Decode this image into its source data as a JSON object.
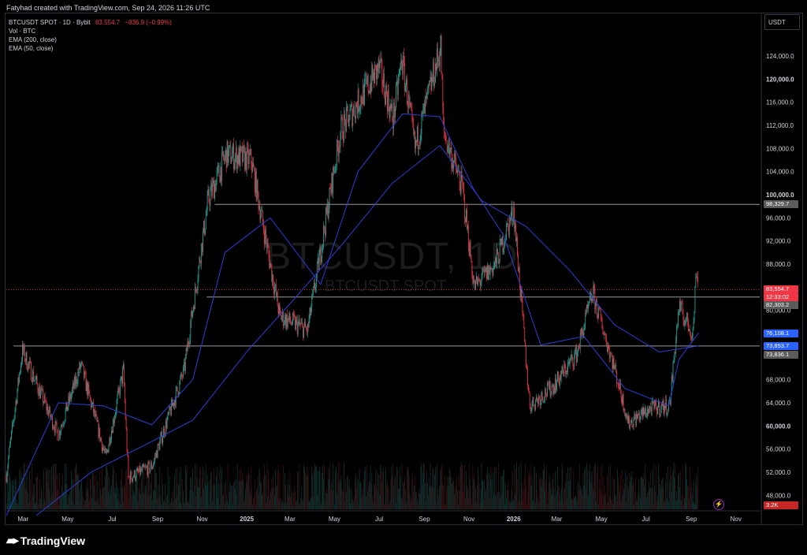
{
  "header": {
    "caption": "Fatyhad created with TradingView.com, Sep 24, 2026 11:26 UTC"
  },
  "legend": {
    "symbol": "BTCUSDT SPOT · 1D · Bybit",
    "price": "83,554.7",
    "change": "−836.9 (−0.99%)",
    "indicators": [
      "Vol · BTC",
      "EMA (200, close)",
      "EMA (50, close)"
    ]
  },
  "currency": "USDT",
  "watermark": {
    "main": "BTCUSDT, 1D",
    "sub": "BTCUSDT SPOT"
  },
  "footer": {
    "brand": "TradingView"
  },
  "colors": {
    "background": "#000000",
    "up": "#26a69a",
    "down": "#f23645",
    "ema": "#2a3fd1",
    "hline": "#9a9a9a",
    "current": "#f23645"
  },
  "chart_data": {
    "type": "candlestick",
    "title": "BTCUSDT, 1D",
    "x_axis_labels": [
      "Mar",
      "May",
      "Jul",
      "Sep",
      "Nov",
      "2025",
      "Mar",
      "May",
      "Jul",
      "Sep",
      "Nov",
      "2026",
      "Mar",
      "May",
      "Jul",
      "Sep",
      "Nov"
    ],
    "y_axis_labels": [
      "124,000.0",
      "120,000.0",
      "116,000.0",
      "112,000.0",
      "108,000.0",
      "104,000.0",
      "100,000.0",
      "96,000.0",
      "92,000.0",
      "88,000.0",
      "80,000.0",
      "68,000.0",
      "64,000.0",
      "60,000.0",
      "56,000.0",
      "52,000.0",
      "48,000.0"
    ],
    "ylim": [
      44500,
      124000
    ],
    "close_series": [
      {
        "date": "2024-02-20",
        "close": 51500
      },
      {
        "date": "2024-03-13",
        "close": 73000
      },
      {
        "date": "2024-05-01",
        "close": 58500
      },
      {
        "date": "2024-06-01",
        "close": 70500
      },
      {
        "date": "2024-07-05",
        "close": 54500
      },
      {
        "date": "2024-07-29",
        "close": 69500
      },
      {
        "date": "2024-08-05",
        "close": 51000
      },
      {
        "date": "2024-09-06",
        "close": 53000
      },
      {
        "date": "2024-10-20",
        "close": 69500
      },
      {
        "date": "2024-11-22",
        "close": 99000
      },
      {
        "date": "2024-12-17",
        "close": 107000
      },
      {
        "date": "2025-01-20",
        "close": 106000
      },
      {
        "date": "2025-02-28",
        "close": 79000
      },
      {
        "date": "2025-04-07",
        "close": 76500
      },
      {
        "date": "2025-05-22",
        "close": 111000
      },
      {
        "date": "2025-07-14",
        "close": 122000
      },
      {
        "date": "2025-08-02",
        "close": 113000
      },
      {
        "date": "2025-08-14",
        "close": 123500
      },
      {
        "date": "2025-09-01",
        "close": 108000
      },
      {
        "date": "2025-10-06",
        "close": 125500
      },
      {
        "date": "2025-10-10",
        "close": 111000
      },
      {
        "date": "2025-11-05",
        "close": 101000
      },
      {
        "date": "2025-11-21",
        "close": 84000
      },
      {
        "date": "2025-12-20",
        "close": 88000
      },
      {
        "date": "2026-01-14",
        "close": 97500
      },
      {
        "date": "2026-02-05",
        "close": 63500
      },
      {
        "date": "2026-03-10",
        "close": 67000
      },
      {
        "date": "2026-04-10",
        "close": 72500
      },
      {
        "date": "2026-05-02",
        "close": 83000
      },
      {
        "date": "2026-06-01",
        "close": 70000
      },
      {
        "date": "2026-06-20",
        "close": 60500
      },
      {
        "date": "2026-07-20",
        "close": 63000
      },
      {
        "date": "2026-08-15",
        "close": 63500
      },
      {
        "date": "2026-08-28",
        "close": 80500
      },
      {
        "date": "2026-09-16",
        "close": 76000
      },
      {
        "date": "2026-09-21",
        "close": 87500
      },
      {
        "date": "2026-09-24",
        "close": 83554.7
      }
    ],
    "ema50": [
      {
        "date": "2024-02-20",
        "value": 44500
      },
      {
        "date": "2024-05-01",
        "value": 64000
      },
      {
        "date": "2024-07-01",
        "value": 63500
      },
      {
        "date": "2024-09-06",
        "value": 60200
      },
      {
        "date": "2024-11-01",
        "value": 68000
      },
      {
        "date": "2024-12-15",
        "value": 90000
      },
      {
        "date": "2025-02-15",
        "value": 96000
      },
      {
        "date": "2025-04-25",
        "value": 84500
      },
      {
        "date": "2025-06-15",
        "value": 104000
      },
      {
        "date": "2025-08-15",
        "value": 114000
      },
      {
        "date": "2025-10-05",
        "value": 113500
      },
      {
        "date": "2025-11-20",
        "value": 101000
      },
      {
        "date": "2025-12-31",
        "value": 93000
      },
      {
        "date": "2026-02-20",
        "value": 74000
      },
      {
        "date": "2026-04-20",
        "value": 75500
      },
      {
        "date": "2026-06-15",
        "value": 66500
      },
      {
        "date": "2026-08-14",
        "value": 63500
      },
      {
        "date": "2026-08-28",
        "value": 71500
      },
      {
        "date": "2026-09-24",
        "value": 76108.1
      }
    ],
    "ema200": [
      {
        "date": "2024-04-01",
        "value": 44500
      },
      {
        "date": "2024-06-15",
        "value": 52000
      },
      {
        "date": "2024-09-01",
        "value": 57000
      },
      {
        "date": "2024-11-01",
        "value": 61000
      },
      {
        "date": "2025-01-15",
        "value": 73000
      },
      {
        "date": "2025-03-20",
        "value": 82000
      },
      {
        "date": "2025-05-25",
        "value": 91500
      },
      {
        "date": "2025-08-01",
        "value": 102000
      },
      {
        "date": "2025-10-05",
        "value": 108500
      },
      {
        "date": "2025-12-01",
        "value": 99000
      },
      {
        "date": "2026-01-31",
        "value": 94500
      },
      {
        "date": "2026-03-31",
        "value": 87000
      },
      {
        "date": "2026-06-01",
        "value": 77500
      },
      {
        "date": "2026-08-01",
        "value": 72800
      },
      {
        "date": "2026-09-24",
        "value": 73853.7
      }
    ],
    "horizontal_levels": [
      {
        "label": "98,329.7",
        "value": 98329.7,
        "from": "2024-12-01"
      },
      {
        "label": "82,303.2",
        "value": 82303.2,
        "from": "2024-11-20"
      },
      {
        "label": "73,836.1",
        "value": 73836.1,
        "from": "2024-03-01"
      }
    ],
    "price_labels": {
      "bold_prices": [
        "120,000.0",
        "100,000.0",
        "60,000.0"
      ],
      "current_price": "83,554.7",
      "countdown": "12:33:02",
      "ema50_value": "76,108.1",
      "ema200_value": "73,853.7",
      "volume": "3.2K"
    }
  }
}
